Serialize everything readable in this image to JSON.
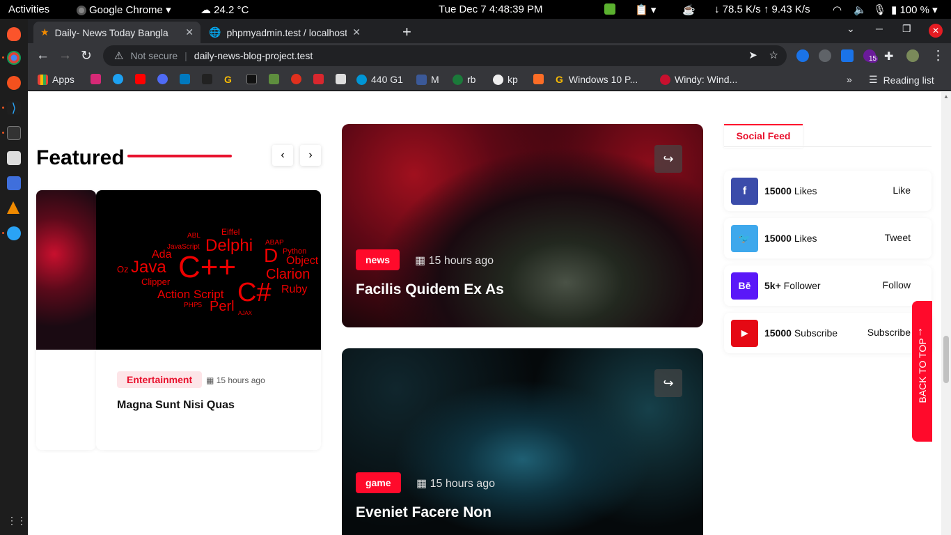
{
  "system_bar": {
    "activities": "Activities",
    "app_name": "Google Chrome",
    "weather": "24.2 °C",
    "datetime": "Tue Dec 7   4:48:39 PM",
    "network_speed": "↓ 78.5 K/s ↑ 9.43 K/s",
    "battery": "100 %"
  },
  "tabs": [
    {
      "title": "Daily- News Today Bangla",
      "active": true
    },
    {
      "title": "phpmyadmin.test / localhost",
      "active": false
    }
  ],
  "address_bar": {
    "security_label": "Not secure",
    "url": "daily-news-blog-project.test"
  },
  "extension_badge": "15",
  "bookmarks": {
    "apps": "Apps",
    "items": [
      "440 G1",
      "M",
      "rb",
      "kp",
      "Windows 10 P...",
      "Windy: Wind..."
    ],
    "reading_list": "Reading list"
  },
  "featured": {
    "heading": "Featured",
    "card": {
      "image_words": [
        "ABL",
        "Eiffel",
        "ABAP",
        "JavaScript",
        "Delphi",
        "D",
        "Python",
        "Ada",
        "Object",
        "Java",
        "C++",
        "Clarion",
        "Oz",
        "Clipper",
        "C#",
        "Ruby",
        "Action Script",
        "PHP5",
        "Perl",
        "AJAX"
      ],
      "category": "Entertainment",
      "date": "15 hours ago",
      "title": "Magna Sunt Nisi Quas"
    }
  },
  "posts": [
    {
      "category": "news",
      "date": "15 hours ago",
      "title": "Facilis Quidem Ex As"
    },
    {
      "category": "game",
      "date": "15 hours ago",
      "title": "Eveniet Facere Non"
    }
  ],
  "social_feed": {
    "tab_label": "Social Feed",
    "items": [
      {
        "network": "facebook",
        "icon": "f",
        "color": "#3b4caa",
        "count": "15000",
        "unit": "Likes",
        "action": "Like"
      },
      {
        "network": "twitter",
        "icon": "twitter-bird-icon",
        "color": "#3ea8ec",
        "count": "15000",
        "unit": "Likes",
        "action": "Tweet"
      },
      {
        "network": "behance",
        "icon": "Bē",
        "color": "#5a18f8",
        "count": "5k+",
        "unit": "Follower",
        "action": "Follow"
      },
      {
        "network": "youtube",
        "icon": "▶",
        "color": "#e50914",
        "count": "15000",
        "unit": "Subscribe",
        "action": "Subscribe"
      }
    ]
  },
  "back_to_top": "BACK TO TOP",
  "colors": {
    "accent": "#ff0a2b",
    "chrome_dark": "#35363a",
    "tab_bar": "#202124"
  }
}
